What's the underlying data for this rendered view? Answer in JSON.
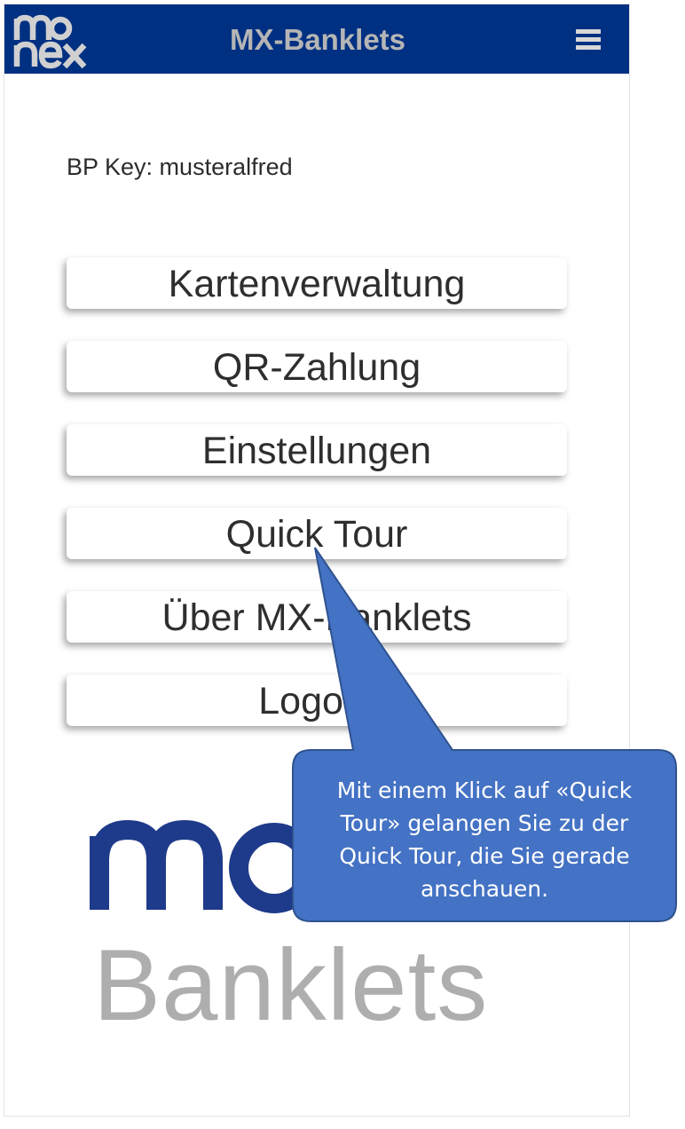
{
  "header": {
    "logo_text": "monex",
    "title": "MX-Banklets",
    "menu_icon": "hamburger-menu-icon",
    "background_color": "#003082"
  },
  "account": {
    "bp_key_label": "BP Key: musteralfred"
  },
  "menu": {
    "items": [
      {
        "label": "Kartenverwaltung"
      },
      {
        "label": "QR-Zahlung"
      },
      {
        "label": "Einstellungen"
      },
      {
        "label": "Quick Tour"
      },
      {
        "label": "Über MX-Banklets"
      },
      {
        "label": "Logout"
      }
    ]
  },
  "branding": {
    "logo_text": "monex",
    "wordmark": "Banklets",
    "logo_color": "#1e3a8a",
    "wordmark_color": "#aeaeae"
  },
  "callout": {
    "text_lines": [
      "Mit einem Klick auf «Quick",
      "Tour» gelangen Sie zu der",
      "Quick Tour, die Sie gerade",
      "anschauen."
    ],
    "fill_color": "#4472c4"
  }
}
